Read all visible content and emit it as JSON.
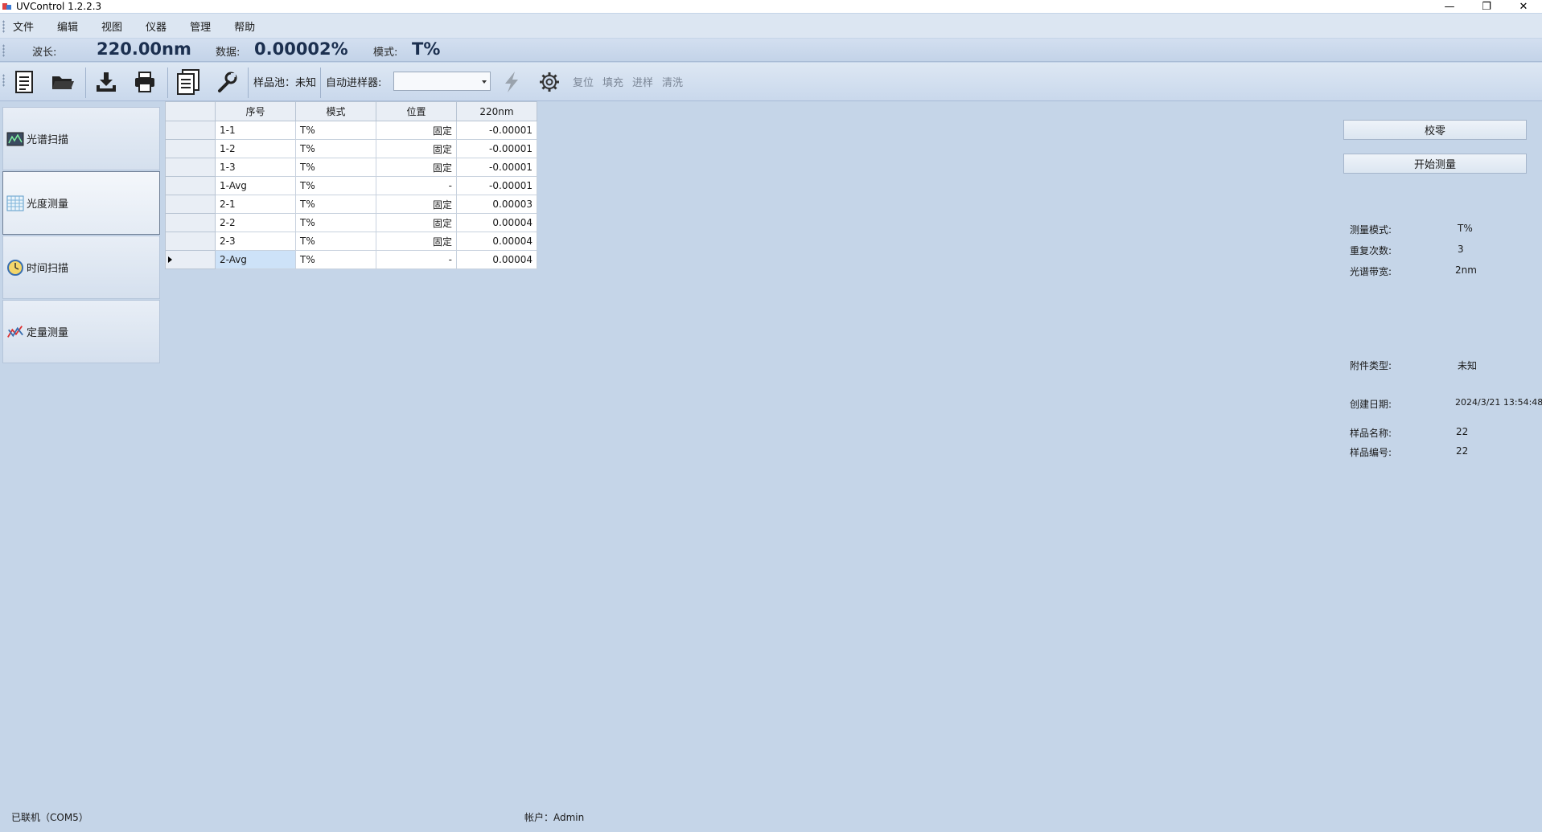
{
  "window": {
    "title": "UVControl 1.2.2.3",
    "minimize": "—",
    "restore": "❐",
    "close": "✕"
  },
  "menu": [
    "文件",
    "编辑",
    "视图",
    "仪器",
    "管理",
    "帮助"
  ],
  "readout": {
    "wavelength_label": "波长:",
    "wavelength_value": "220.00nm",
    "data_label": "数据:",
    "data_value": "0.00002%",
    "mode_label": "模式:",
    "mode_value": "T%"
  },
  "toolbar": {
    "cell_label": "样品池：未知",
    "sampler_label": "自动进样器:",
    "sampler_value": "",
    "reset": "复位",
    "fill": "填充",
    "inject": "进样",
    "wash": "清洗"
  },
  "nav": [
    {
      "label": "光谱扫描",
      "icon": "spectrum-chart-icon"
    },
    {
      "label": "光度测量",
      "icon": "table-grid-icon"
    },
    {
      "label": "时间扫描",
      "icon": "clock-icon"
    },
    {
      "label": "定量测量",
      "icon": "quant-chart-icon"
    }
  ],
  "grid": {
    "headers": [
      "序号",
      "模式",
      "位置",
      "220nm"
    ],
    "rows": [
      [
        "1-1",
        "T%",
        "固定",
        "-0.00001"
      ],
      [
        "1-2",
        "T%",
        "固定",
        "-0.00001"
      ],
      [
        "1-3",
        "T%",
        "固定",
        "-0.00001"
      ],
      [
        "1-Avg",
        "T%",
        "-",
        "-0.00001"
      ],
      [
        "2-1",
        "T%",
        "固定",
        "0.00003"
      ],
      [
        "2-2",
        "T%",
        "固定",
        "0.00004"
      ],
      [
        "2-3",
        "T%",
        "固定",
        "0.00004"
      ],
      [
        "2-Avg",
        "T%",
        "-",
        "0.00004"
      ]
    ]
  },
  "right": {
    "zero_btn": "校零",
    "start_btn": "开始测量",
    "mode_label": "测量模式:",
    "mode_value": "T%",
    "repeat_label": "重复次数:",
    "repeat_value": "3",
    "bandwidth_label": "光谱带宽:",
    "bandwidth_value": "2nm",
    "accessory_label": "附件类型:",
    "accessory_value": "未知",
    "date_label": "创建日期:",
    "date_value": "2024/3/21 13:54:48",
    "sample_name_label": "样品名称:",
    "sample_name_value": "22",
    "sample_no_label": "样品编号:",
    "sample_no_value": "22"
  },
  "status": {
    "connection": "已联机（COM5）",
    "account": "帐户：Admin"
  },
  "colors": {
    "background": "#c5d5e8",
    "accent": "#1b2f4f",
    "selection": "#cde2f8"
  }
}
